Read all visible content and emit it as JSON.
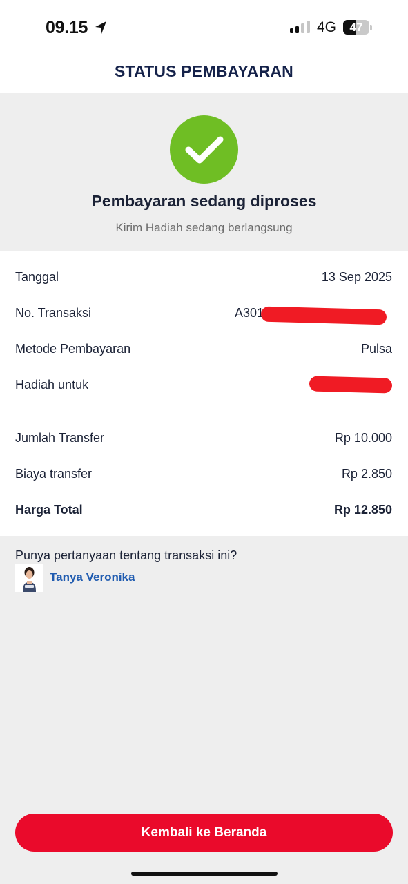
{
  "status_bar": {
    "time": "09.15",
    "network": "4G",
    "battery": "47",
    "battery_level": 0.47
  },
  "header": {
    "title": "STATUS PEMBAYARAN"
  },
  "hero": {
    "icon": "check-icon",
    "title": "Pembayaran sedang diproses",
    "subtitle": "Kirim Hadiah sedang berlangsung",
    "accent_color": "#6fbe24"
  },
  "details": {
    "date": {
      "label": "Tanggal",
      "value": "13 Sep 2025"
    },
    "transaction": {
      "label": "No. Transaksi",
      "value": "A301"
    },
    "method": {
      "label": "Metode Pembayaran",
      "value": "Pulsa"
    },
    "recipient": {
      "label": "Hadiah untuk",
      "value": ""
    },
    "amount": {
      "label": "Jumlah Transfer",
      "value": "Rp 10.000"
    },
    "fee": {
      "label": "Biaya transfer",
      "value": "Rp 2.850"
    },
    "total": {
      "label": "Harga Total",
      "value": "Rp 12.850"
    }
  },
  "help": {
    "question": "Punya pertanyaan tentang transaksi ini?",
    "link": "Tanya Veronika",
    "avatar_icon": "veronika-avatar-icon"
  },
  "cta": {
    "label": "Kembali ke Beranda",
    "color": "#ea0a2b"
  }
}
